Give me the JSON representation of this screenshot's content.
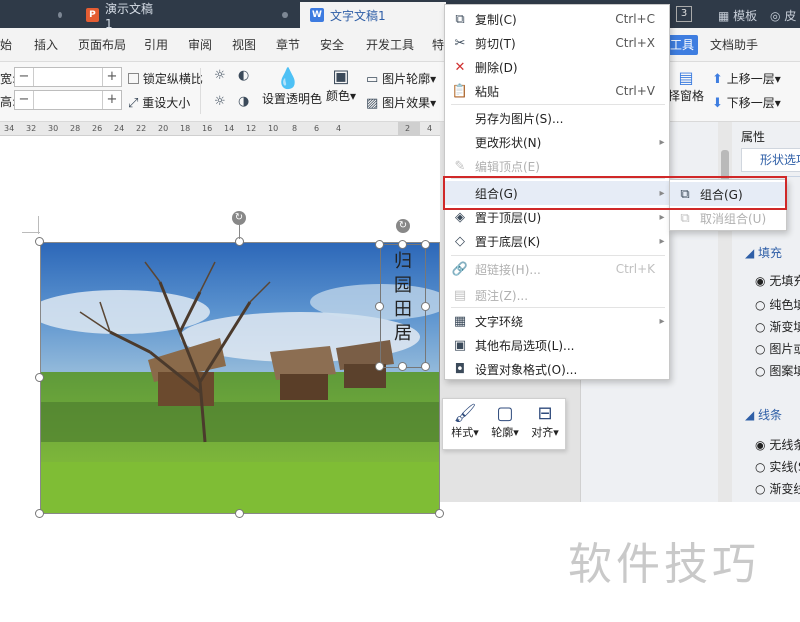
{
  "titlebar": {
    "tabs": [
      {
        "label": "演示文稿1",
        "icon": "presentation-doc-icon",
        "color": "#e45d33"
      },
      {
        "label": "文字文稿1",
        "icon": "writer-doc-icon",
        "color": "#3d7be0"
      }
    ],
    "badge": "3",
    "right_items": [
      "模板",
      "皮"
    ]
  },
  "menubar": {
    "items": [
      "始",
      "插入",
      "页面布局",
      "引用",
      "审阅",
      "视图",
      "章节",
      "安全",
      "开发工具",
      "特"
    ],
    "highlight": "工具",
    "extra": "文档助手"
  },
  "toolbar": {
    "width_label": "宽:",
    "height_label": "高:",
    "lock_ratio": "锁定纵横比",
    "reset_size": "重设大小",
    "transparent": "设置透明色",
    "color": "颜色",
    "picture_outline": "图片轮廓",
    "picture_effect": "图片效果",
    "selection_pane": "择窗格",
    "bring_forward": "上移一层",
    "send_backward": "下移一层"
  },
  "ruler": {
    "ticks": [
      "34",
      "32",
      "30",
      "28",
      "26",
      "24",
      "22",
      "20",
      "18",
      "16",
      "14",
      "12",
      "10",
      "8",
      "6",
      "4",
      "2"
    ],
    "right_ticks": [
      "2",
      "4"
    ]
  },
  "context_menu": {
    "items": [
      {
        "label": "复制(C)",
        "shortcut": "Ctrl+C",
        "icon": "copy-icon",
        "disabled": false,
        "submenu": false
      },
      {
        "label": "剪切(T)",
        "shortcut": "Ctrl+X",
        "icon": "cut-icon",
        "disabled": false,
        "submenu": false
      },
      {
        "label": "删除(D)",
        "shortcut": "",
        "icon": "delete-icon",
        "disabled": false,
        "submenu": false
      },
      {
        "label": "粘贴",
        "shortcut": "Ctrl+V",
        "icon": "paste-icon",
        "disabled": false,
        "submenu": false
      },
      {
        "label": "另存为图片(S)...",
        "shortcut": "",
        "icon": "",
        "disabled": false,
        "submenu": false
      },
      {
        "label": "更改形状(N)",
        "shortcut": "",
        "icon": "",
        "disabled": false,
        "submenu": true
      },
      {
        "label": "编辑顶点(E)",
        "shortcut": "",
        "icon": "edit-points-icon",
        "disabled": true,
        "submenu": false
      },
      {
        "label": "组合(G)",
        "shortcut": "",
        "icon": "",
        "disabled": false,
        "submenu": true,
        "active": true
      },
      {
        "label": "置于顶层(U)",
        "shortcut": "",
        "icon": "bring-to-front-icon",
        "disabled": false,
        "submenu": true
      },
      {
        "label": "置于底层(K)",
        "shortcut": "",
        "icon": "send-to-back-icon",
        "disabled": false,
        "submenu": true
      },
      {
        "label": "超链接(H)...",
        "shortcut": "Ctrl+K",
        "icon": "hyperlink-icon",
        "disabled": true,
        "submenu": false
      },
      {
        "label": "题注(Z)...",
        "shortcut": "",
        "icon": "caption-icon",
        "disabled": true,
        "submenu": false
      },
      {
        "label": "文字环绕",
        "shortcut": "",
        "icon": "text-wrap-icon",
        "disabled": false,
        "submenu": true
      },
      {
        "label": "其他布局选项(L)...",
        "shortcut": "",
        "icon": "layout-options-icon",
        "disabled": false,
        "submenu": false
      },
      {
        "label": "设置对象格式(O)...",
        "shortcut": "",
        "icon": "format-object-icon",
        "disabled": false,
        "submenu": false
      }
    ]
  },
  "submenu": {
    "items": [
      {
        "label": "组合(G)",
        "disabled": false
      },
      {
        "label": "取消组合(U)",
        "disabled": true
      }
    ]
  },
  "mini_toolbar": {
    "items": [
      {
        "label": "样式",
        "icon": "brush-icon"
      },
      {
        "label": "轮廓",
        "icon": "outline-icon"
      },
      {
        "label": "对齐",
        "icon": "align-icon"
      }
    ]
  },
  "right_panel": {
    "title": "属性",
    "tab": "形状选项",
    "fill_section": "填充",
    "fill_options": [
      "无填充",
      "纯色填",
      "渐变填",
      "图片或",
      "图案填"
    ],
    "line_section": "线条",
    "line_options": [
      "无线条",
      "实线(S",
      "渐变线"
    ]
  },
  "textbox": {
    "text": "归园田居"
  },
  "watermark": "软件技巧"
}
